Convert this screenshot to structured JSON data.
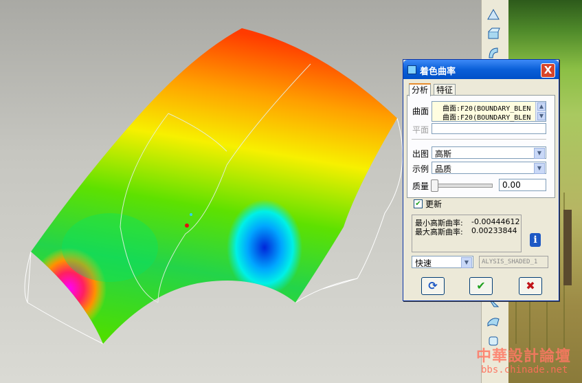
{
  "dialog": {
    "title": "着色曲率",
    "close_label": "X",
    "tabs": [
      {
        "label": "分析",
        "active": true
      },
      {
        "label": "特征",
        "active": false
      }
    ],
    "surface_label": "曲面",
    "surface_items": [
      "曲面:F20(BOUNDARY_BLEN",
      "曲面:F20(BOUNDARY_BLEN"
    ],
    "plane_label": "平面",
    "output_label": "出图",
    "output_value": "高斯",
    "display_label": "示例",
    "display_value": "品质",
    "quality_label": "质量",
    "quality_value": "0.00",
    "update_label": "更新",
    "update_checked": true,
    "results": [
      {
        "label": "最小高斯曲率:",
        "value": "-0.00444612"
      },
      {
        "label": "最大高斯曲率:",
        "value": "0.00233844"
      }
    ],
    "mode_value": "快速",
    "analysis_name": "ALYSIS_SHADED_1",
    "buttons": {
      "repeat": "repeat-icon",
      "ok": "check-icon",
      "cancel": "cancel-icon"
    }
  },
  "watermark": {
    "text": "中華設計論壇",
    "url": "bbs.chinade.net"
  },
  "colors": {
    "title_bar": "#0a5fd8",
    "close_button": "#d7452a",
    "ok_check": "#21a121",
    "cancel_x": "#c0141a",
    "dialog_bg": "#ece9d8"
  }
}
